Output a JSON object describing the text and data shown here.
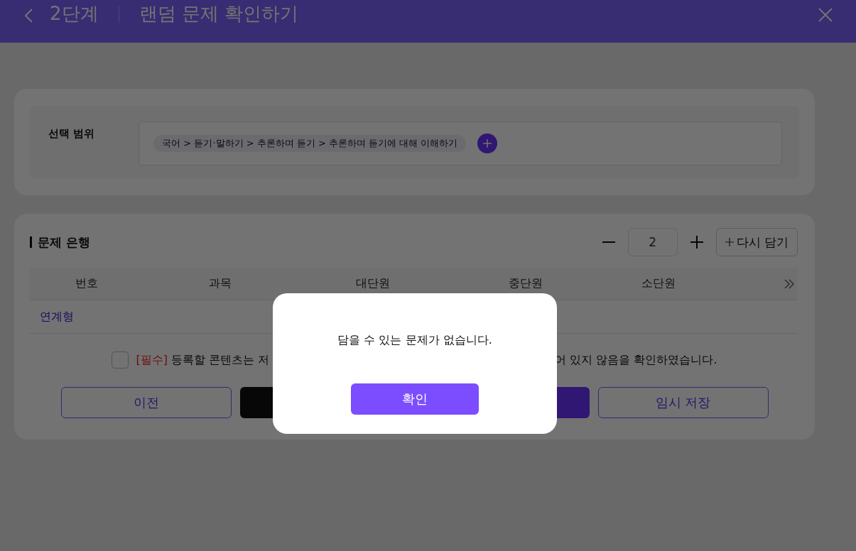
{
  "header": {
    "step": "2단계",
    "title": "랜덤 문제 확인하기"
  },
  "scope": {
    "label": "선택 범위",
    "chips": [
      "국어 > 듣기·말하기 > 추론하며 듣기 > 추론하며 듣기에 대해 이해하기"
    ]
  },
  "bank": {
    "title": "문제 은행",
    "count": "2",
    "refill": "다시 담기",
    "columns": [
      "번호",
      "과목",
      "대단원",
      "중단원",
      "소단원"
    ],
    "rows": [
      {
        "type": "연계형"
      }
    ]
  },
  "agreement": {
    "checked": false,
    "text_left": "**[필수]** 등록할 콘텐츠는 저",
    "text_right": "어 있지 않음을 확인하였습니다."
  },
  "actions": [
    {
      "label": "이전",
      "kind": "outline"
    },
    {
      "kind": "dark"
    },
    {
      "kind": "primary"
    },
    {
      "label": "임시 저장",
      "kind": "outline"
    }
  ],
  "dialog": {
    "message": "담을 수 있는 문제가 없습니다.",
    "confirm": "확인"
  }
}
